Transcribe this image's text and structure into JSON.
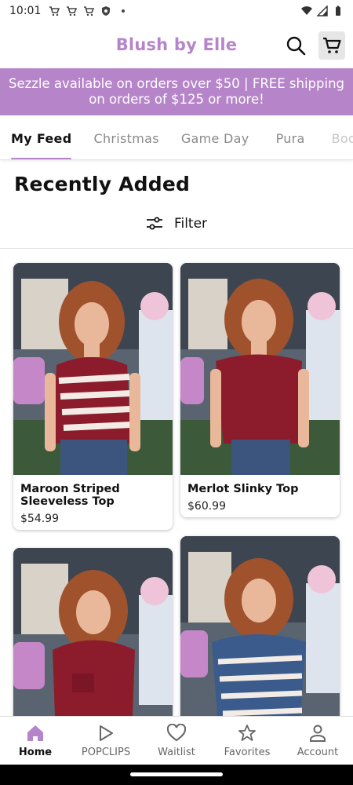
{
  "status": {
    "time": "10:01"
  },
  "header": {
    "brand": "Blush by Elle"
  },
  "promo": {
    "text": "Sezzle available on orders over $50 | FREE shipping on orders of $125 or more!"
  },
  "tabs": [
    {
      "label": "My Feed"
    },
    {
      "label": "Christmas"
    },
    {
      "label": "Game Day"
    },
    {
      "label": "Pura"
    },
    {
      "label": "Body"
    }
  ],
  "section": {
    "title": "Recently Added",
    "filter_label": "Filter"
  },
  "products": [
    {
      "name": "Maroon Striped Sleeveless Top",
      "price": "$54.99"
    },
    {
      "name": "Merlot Slinky Top",
      "price": "$60.99"
    },
    {
      "name": "",
      "price": ""
    },
    {
      "name": "",
      "price": ""
    }
  ],
  "nav": [
    {
      "label": "Home",
      "icon": "home-icon"
    },
    {
      "label": "POPCLIPS",
      "icon": "play-icon"
    },
    {
      "label": "Waitlist",
      "icon": "heart-icon"
    },
    {
      "label": "Favorites",
      "icon": "star-icon"
    },
    {
      "label": "Account",
      "icon": "person-icon"
    }
  ],
  "colors": {
    "accent": "#b685c9",
    "maroon": "#8c1c2c",
    "navy": "#3a5b8c"
  }
}
